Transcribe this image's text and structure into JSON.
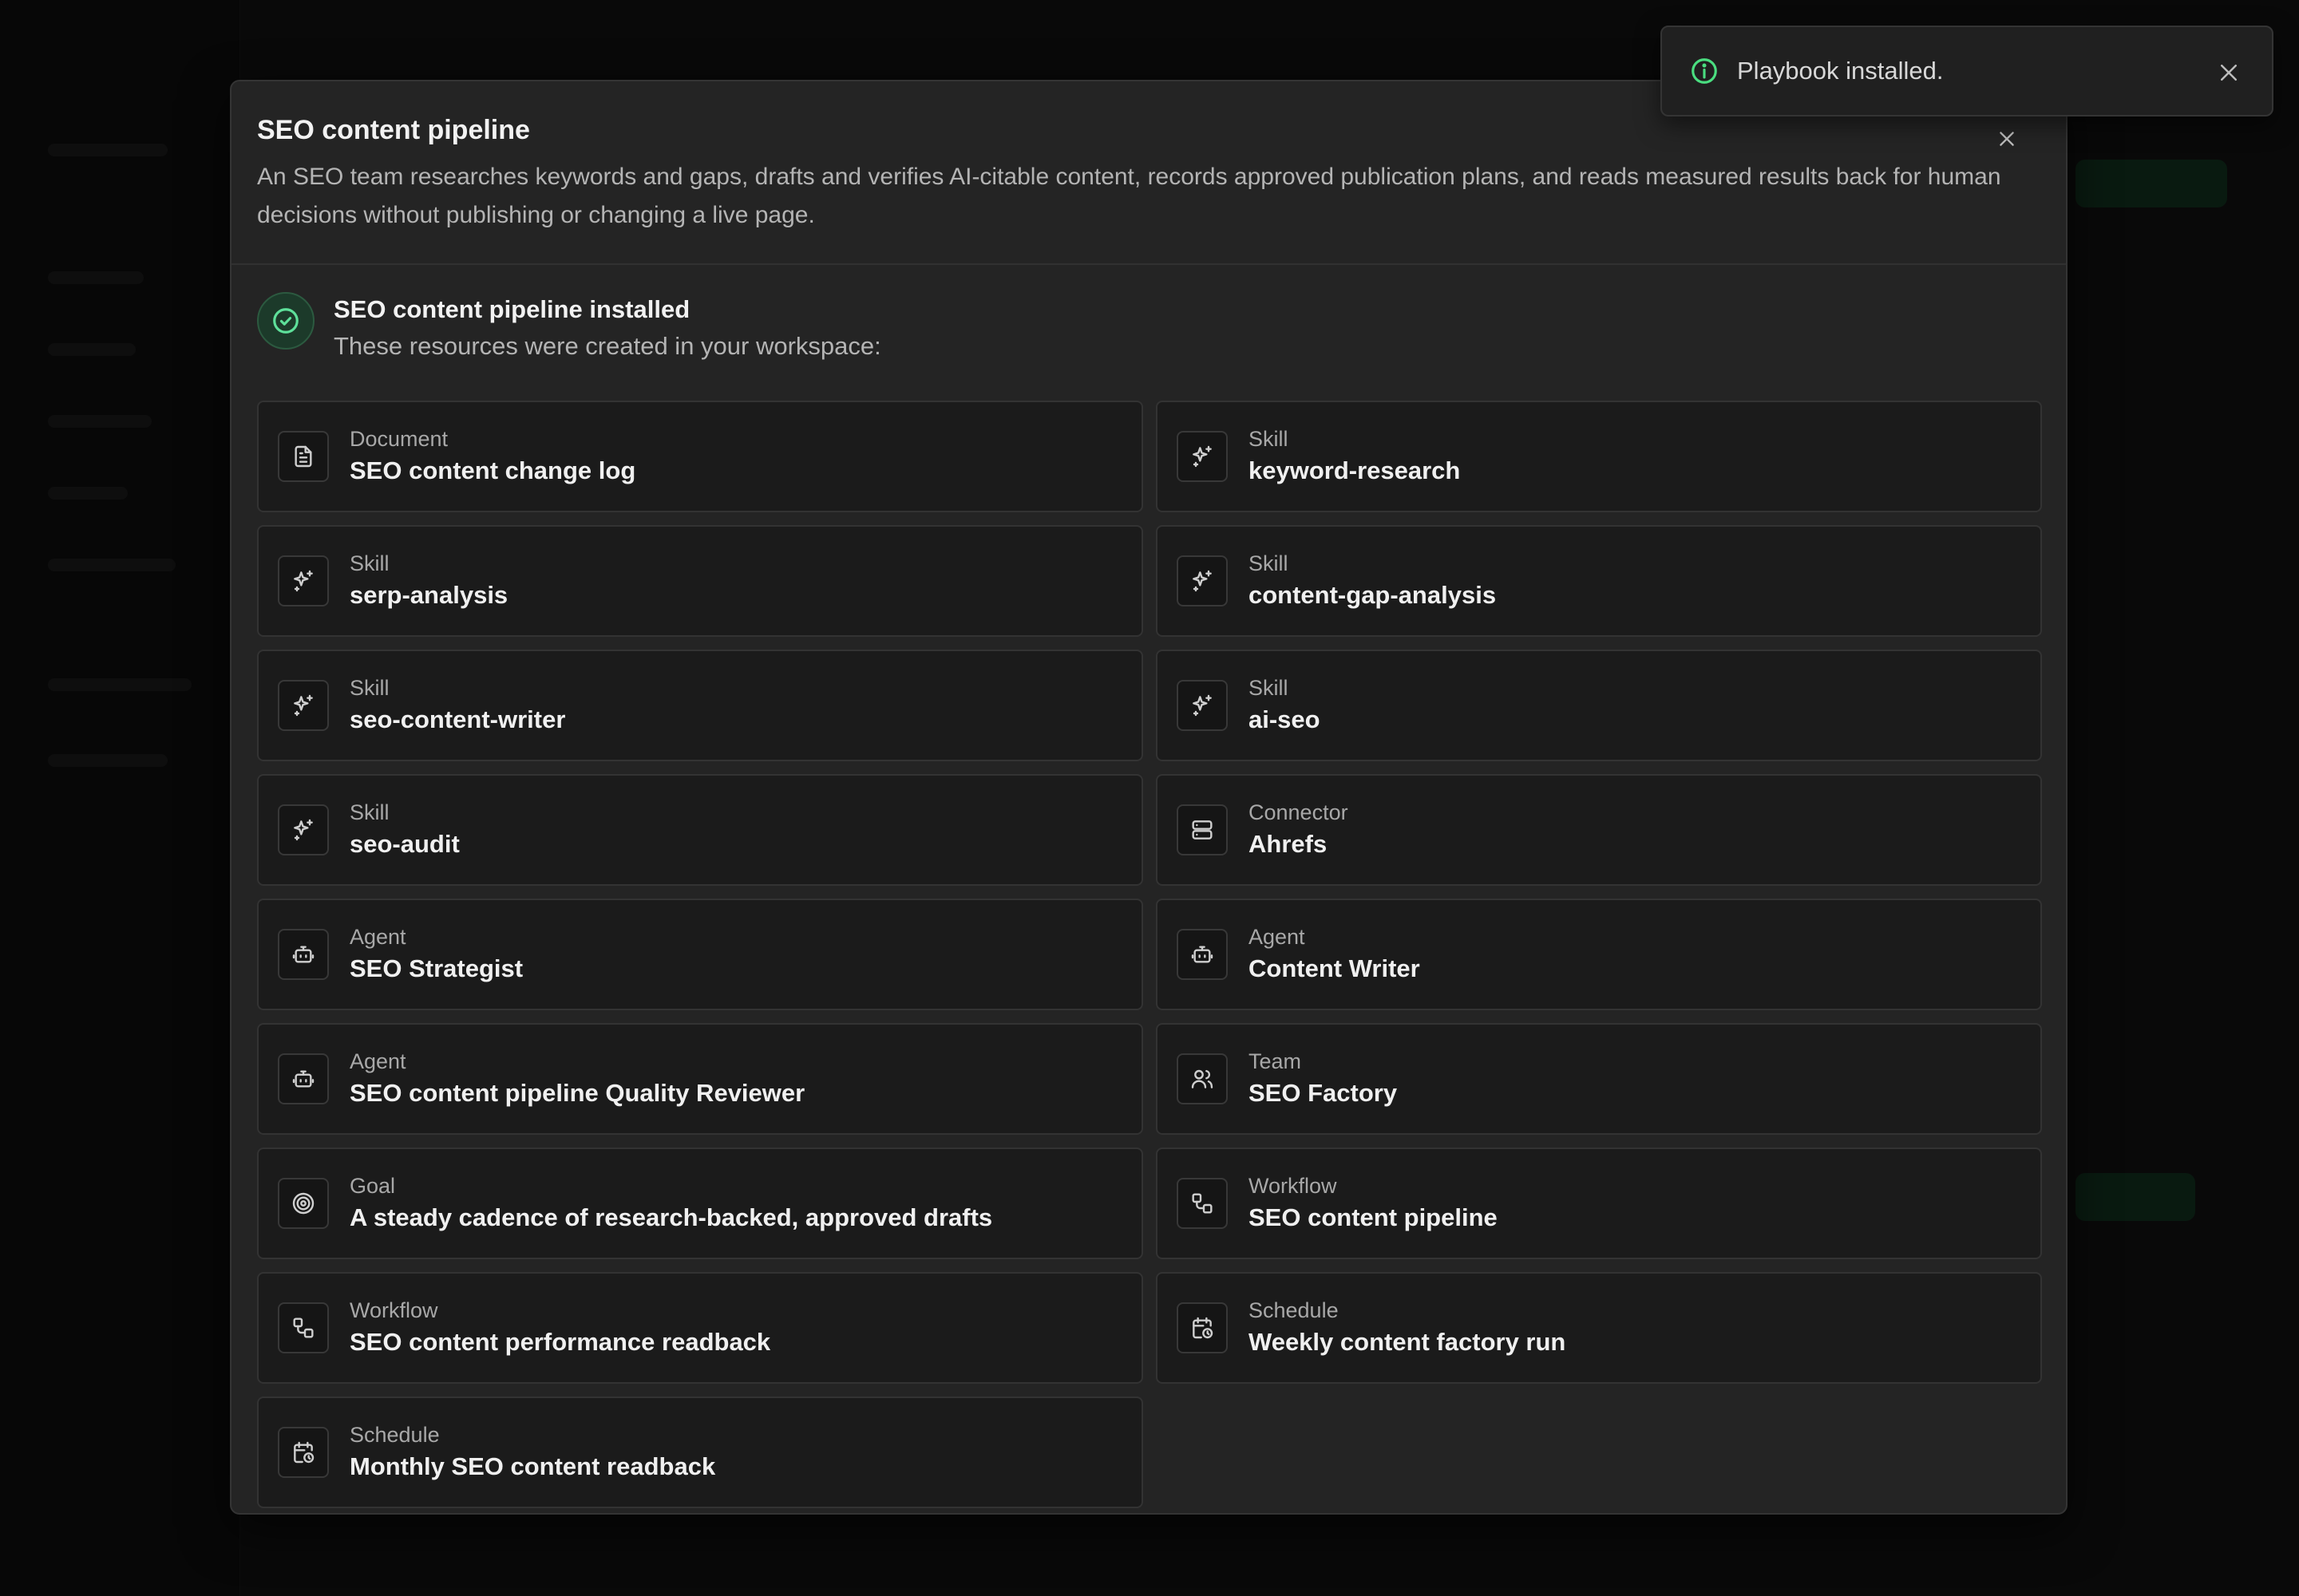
{
  "colors": {
    "accent": "#4ade80",
    "modal_bg": "#242424",
    "card_bg": "#1b1b1b"
  },
  "modal": {
    "title": "SEO content pipeline",
    "description": "An SEO team researches keywords and gaps, drafts and verifies AI-citable content, records approved publication plans, and reads measured results back for human decisions without publishing or changing a live page.",
    "close_icon": "close-icon"
  },
  "success": {
    "title": "SEO content pipeline installed",
    "subtitle": "These resources were created in your workspace:",
    "icon": "check-circle-icon"
  },
  "resources": [
    {
      "kind": "Document",
      "name": "SEO content change log",
      "icon": "document-icon"
    },
    {
      "kind": "Skill",
      "name": "keyword-research",
      "icon": "sparkles-icon"
    },
    {
      "kind": "Skill",
      "name": "serp-analysis",
      "icon": "sparkles-icon"
    },
    {
      "kind": "Skill",
      "name": "content-gap-analysis",
      "icon": "sparkles-icon"
    },
    {
      "kind": "Skill",
      "name": "seo-content-writer",
      "icon": "sparkles-icon"
    },
    {
      "kind": "Skill",
      "name": "ai-seo",
      "icon": "sparkles-icon"
    },
    {
      "kind": "Skill",
      "name": "seo-audit",
      "icon": "sparkles-icon"
    },
    {
      "kind": "Connector",
      "name": "Ahrefs",
      "icon": "server-icon"
    },
    {
      "kind": "Agent",
      "name": "SEO Strategist",
      "icon": "bot-icon"
    },
    {
      "kind": "Agent",
      "name": "Content Writer",
      "icon": "bot-icon"
    },
    {
      "kind": "Agent",
      "name": "SEO content pipeline Quality Reviewer",
      "icon": "bot-icon"
    },
    {
      "kind": "Team",
      "name": "SEO Factory",
      "icon": "users-icon"
    },
    {
      "kind": "Goal",
      "name": "A steady cadence of research-backed, approved drafts",
      "icon": "target-icon"
    },
    {
      "kind": "Workflow",
      "name": "SEO content pipeline",
      "icon": "workflow-icon"
    },
    {
      "kind": "Workflow",
      "name": "SEO content performance readback",
      "icon": "workflow-icon"
    },
    {
      "kind": "Schedule",
      "name": "Weekly content factory run",
      "icon": "calendar-clock-icon"
    },
    {
      "kind": "Schedule",
      "name": "Monthly SEO content readback",
      "icon": "calendar-clock-icon"
    }
  ],
  "toast": {
    "message": "Playbook installed.",
    "icon": "info-icon",
    "close_icon": "close-icon"
  }
}
